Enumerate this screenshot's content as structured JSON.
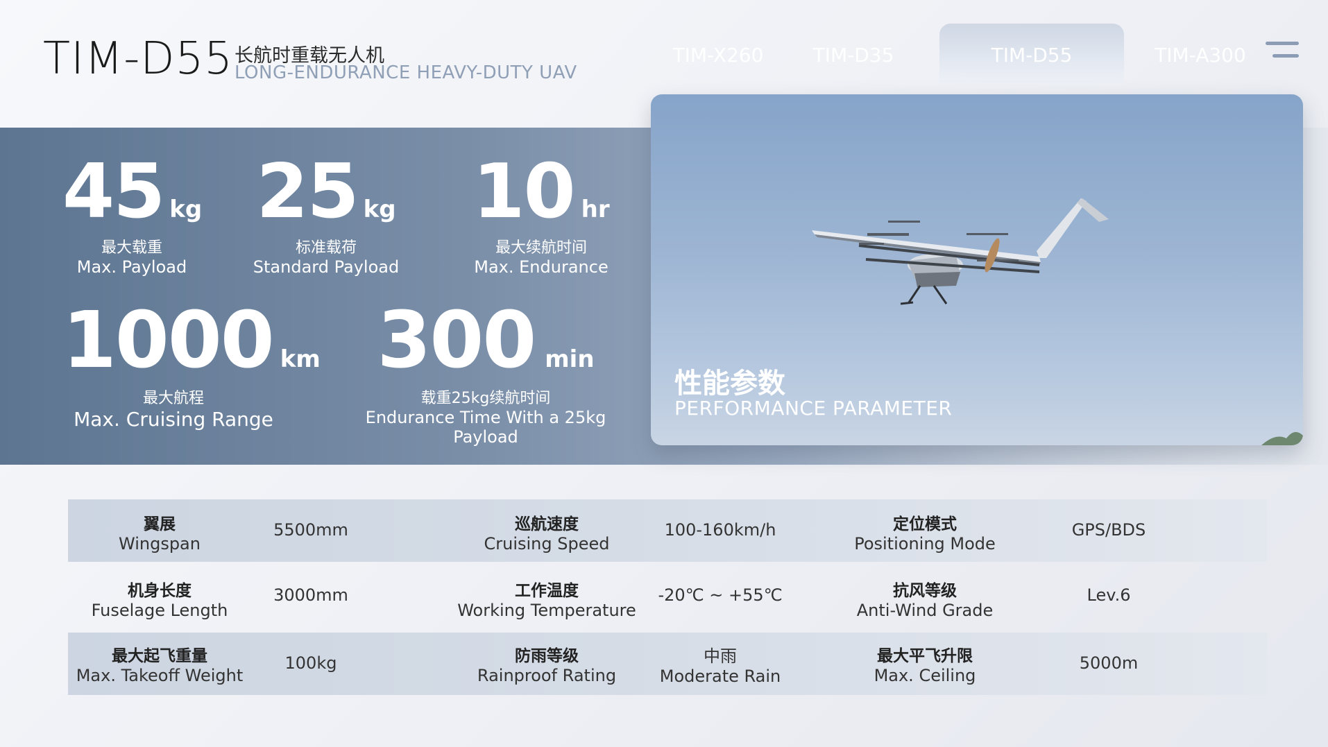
{
  "header": {
    "model": "TIM-D55",
    "title_cn": "长航时重载无人机",
    "title_en": "LONG-ENDURANCE HEAVY-DUTY UAV"
  },
  "tabs": [
    {
      "label": "TIM-X260",
      "active": false
    },
    {
      "label": "TIM-D35",
      "active": false
    },
    {
      "label": "TIM-D55",
      "active": true
    },
    {
      "label": "TIM-A300",
      "active": false
    }
  ],
  "stats": [
    {
      "value": "45",
      "unit": "kg",
      "cn": "最大载重",
      "en": "Max. Payload"
    },
    {
      "value": "25",
      "unit": "kg",
      "cn": "标准载荷",
      "en": "Standard Payload"
    },
    {
      "value": "10",
      "unit": "hr",
      "cn": "最大续航时间",
      "en": "Max. Endurance"
    },
    {
      "value": "1000",
      "unit": "km",
      "cn": "最大航程",
      "en": "Max. Cruising Range"
    },
    {
      "value": "300",
      "unit": "min",
      "cn": "载重25kg续航时间",
      "en": "Endurance Time With a 25kg Payload"
    }
  ],
  "photo": {
    "title_cn": "性能参数",
    "title_en": "PERFORMANCE PARAMETER"
  },
  "specs": [
    [
      {
        "cn": "翼展",
        "en": "Wingspan",
        "value": "5500mm"
      },
      {
        "cn": "巡航速度",
        "en": "Cruising Speed",
        "value": "100-160km/h"
      },
      {
        "cn": "定位模式",
        "en": "Positioning Mode",
        "value": "GPS/BDS"
      }
    ],
    [
      {
        "cn": "机身长度",
        "en": "Fuselage Length",
        "value": "3000mm"
      },
      {
        "cn": "工作温度",
        "en": "Working Temperature",
        "value": "-20℃ ~ +55℃"
      },
      {
        "cn": "抗风等级",
        "en": "Anti-Wind Grade",
        "value": "Lev.6"
      }
    ],
    [
      {
        "cn": "最大起飞重量",
        "en": "Max. Takeoff Weight",
        "value": "100kg"
      },
      {
        "cn": "防雨等级",
        "en": "Rainproof Rating",
        "value_cn": "中雨",
        "value": "Moderate Rain"
      },
      {
        "cn": "最大平飞升限",
        "en": "Max. Ceiling",
        "value": "5000m"
      }
    ]
  ]
}
